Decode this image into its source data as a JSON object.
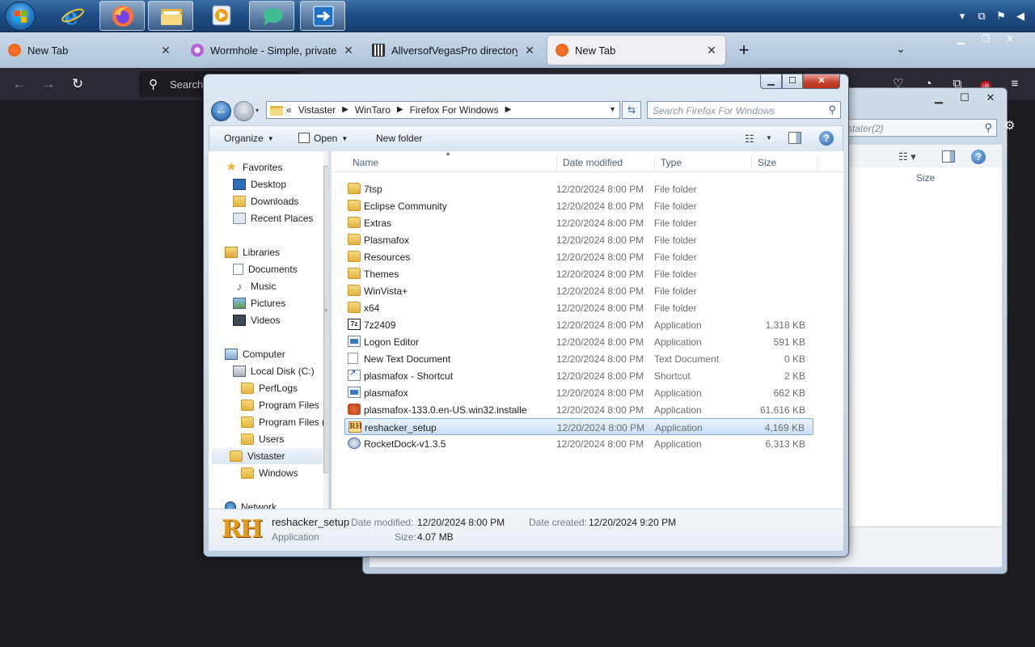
{
  "taskbar": {
    "apps": [
      {
        "name": "internet-explorer"
      },
      {
        "name": "firefox"
      },
      {
        "name": "file-explorer"
      },
      {
        "name": "media-player"
      },
      {
        "name": "chat-app"
      },
      {
        "name": "remote-app"
      }
    ],
    "tray_icons": [
      "chevron-up-icon",
      "network-icon",
      "flag-icon",
      "mute-icon"
    ]
  },
  "browser": {
    "tabs": [
      {
        "label": "New Tab",
        "color": "#e66000"
      },
      {
        "label": "Wormhole - Simple, private file",
        "color": "#b45fd8"
      },
      {
        "label": "AllversofVegasPro directory listi",
        "color": "#333333"
      },
      {
        "label": "New Tab",
        "color": "#e66000"
      }
    ],
    "search_placeholder": "Search"
  },
  "bg_window": {
    "search_placeholder": "stater(2)",
    "size_header": "Size"
  },
  "window": {
    "breadcrumb": [
      "«",
      "Vistaster",
      "WinTaro",
      "Firefox For Windows"
    ],
    "search_placeholder": "Search Firefox For Windows",
    "toolbar": {
      "organize": "Organize",
      "open": "Open",
      "new_folder": "New folder"
    },
    "nav": {
      "favorites": "Favorites",
      "desktop": "Desktop",
      "downloads": "Downloads",
      "recent": "Recent Places",
      "libraries": "Libraries",
      "documents": "Documents",
      "music": "Music",
      "pictures": "Pictures",
      "videos": "Videos",
      "computer": "Computer",
      "local_disk": "Local Disk (C:)",
      "perflogs": "PerfLogs",
      "program_files": "Program Files",
      "program_files_x86": "Program Files (",
      "users": "Users",
      "vistaster": "Vistaster",
      "windows": "Windows",
      "network": "Network"
    },
    "columns": {
      "name": "Name",
      "date": "Date modified",
      "type": "Type",
      "size": "Size"
    },
    "files": [
      {
        "name": "7tsp",
        "date": "12/20/2024 8:00 PM",
        "type": "File folder",
        "size": "",
        "icon": "folder"
      },
      {
        "name": "Eclipse Community",
        "date": "12/20/2024 8:00 PM",
        "type": "File folder",
        "size": "",
        "icon": "folder"
      },
      {
        "name": "Extras",
        "date": "12/20/2024 8:00 PM",
        "type": "File folder",
        "size": "",
        "icon": "folder"
      },
      {
        "name": "Plasmafox",
        "date": "12/20/2024 8:00 PM",
        "type": "File folder",
        "size": "",
        "icon": "folder"
      },
      {
        "name": "Resources",
        "date": "12/20/2024 8:00 PM",
        "type": "File folder",
        "size": "",
        "icon": "folder"
      },
      {
        "name": "Themes",
        "date": "12/20/2024 8:00 PM",
        "type": "File folder",
        "size": "",
        "icon": "folder"
      },
      {
        "name": "WinVista+",
        "date": "12/20/2024 8:00 PM",
        "type": "File folder",
        "size": "",
        "icon": "folder"
      },
      {
        "name": "x64",
        "date": "12/20/2024 8:00 PM",
        "type": "File folder",
        "size": "",
        "icon": "folder"
      },
      {
        "name": "7z2409",
        "date": "12/20/2024 8:00 PM",
        "type": "Application",
        "size": "1,318 KB",
        "icon": "z7"
      },
      {
        "name": "Logon Editor",
        "date": "12/20/2024 8:00 PM",
        "type": "Application",
        "size": "591 KB",
        "icon": "exe"
      },
      {
        "name": "New Text Document",
        "date": "12/20/2024 8:00 PM",
        "type": "Text Document",
        "size": "0 KB",
        "icon": "txt"
      },
      {
        "name": "plasmafox - Shortcut",
        "date": "12/20/2024 8:00 PM",
        "type": "Shortcut",
        "size": "2 KB",
        "icon": "lnk"
      },
      {
        "name": "plasmafox",
        "date": "12/20/2024 8:00 PM",
        "type": "Application",
        "size": "662 KB",
        "icon": "exe"
      },
      {
        "name": "plasmafox-133.0.en-US.win32.installe",
        "date": "12/20/2024 8:00 PM",
        "type": "Application",
        "size": "61,616 KB",
        "icon": "fox"
      },
      {
        "name": "reshacker_setup",
        "date": "12/20/2024 8:00 PM",
        "type": "Application",
        "size": "4,169 KB",
        "icon": "rh",
        "selected": true
      },
      {
        "name": "RocketDock-v1.3.5",
        "date": "12/20/2024 8:00 PM",
        "type": "Application",
        "size": "6,313 KB",
        "icon": "rocket"
      }
    ],
    "details": {
      "name": "reshacker_setup",
      "type": "Application",
      "modified_label": "Date modified:",
      "modified": "12/20/2024 8:00 PM",
      "created_label": "Date created:",
      "created": "12/20/2024 9:20 PM",
      "size_label": "Size:",
      "size": "4.07 MB",
      "icon_text": "RH"
    }
  }
}
